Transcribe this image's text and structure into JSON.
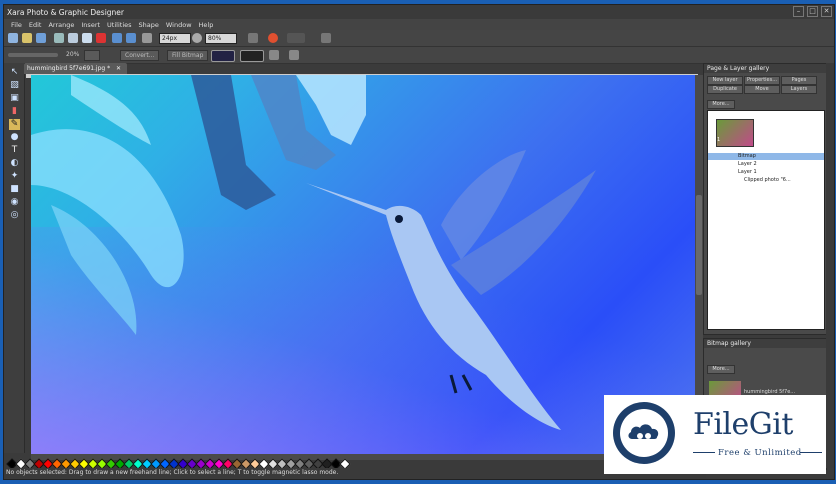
{
  "window": {
    "title": "Xara Photo & Graphic Designer",
    "controls": [
      "–",
      "□",
      "✕"
    ]
  },
  "menu": [
    "File",
    "Edit",
    "Arrange",
    "Insert",
    "Utilities",
    "Shape",
    "Window",
    "Help"
  ],
  "toolbar": {
    "font_size_value": "24px",
    "zoom_value": "80%",
    "zoom_percent_label": "20%",
    "button_convert": "Convert...",
    "button_fill_bitmap": "Fill Bitmap"
  },
  "document": {
    "tab_label": "hummingbird 5f7e691.jpg *"
  },
  "status_bar": {
    "text": "No objects selected: Drag to draw a new freehand line; Click to select a line; T to toggle magnetic lasso mode."
  },
  "page_layer_gallery": {
    "title": "Page & Layer gallery",
    "buttons": [
      "New layer",
      "Properties...",
      "Pages",
      "Duplicate",
      "Move",
      "Layers"
    ],
    "more_label": "More...",
    "page_number": "1",
    "layers": [
      "Bitmap",
      "Layer 2",
      "Layer 1",
      "Clipped photo \"6..."
    ]
  },
  "bitmap_gallery": {
    "title": "Bitmap gallery",
    "more_label": "More...",
    "item_label": "hummingbird 5f7e..."
  },
  "watermark": {
    "brand": "FileGit",
    "tagline": "Free & Unlimited"
  },
  "palette_colors": [
    "#000000",
    "#ffffff",
    "#7f7f7f",
    "#c00000",
    "#ff0000",
    "#ff6600",
    "#ff9900",
    "#ffcc00",
    "#ffff00",
    "#ccff00",
    "#99ff00",
    "#33cc00",
    "#00aa00",
    "#00cc66",
    "#00ffcc",
    "#00ccff",
    "#0099ff",
    "#0066ff",
    "#0033cc",
    "#3300cc",
    "#6600cc",
    "#9900cc",
    "#cc00cc",
    "#ff00cc",
    "#ff0066",
    "#996633",
    "#cc9966",
    "#ffcc99",
    "#ffffff",
    "#e0e0e0",
    "#c0c0c0",
    "#a0a0a0",
    "#808080",
    "#606060",
    "#404040",
    "#202020",
    "#000000",
    "#ffffff"
  ]
}
